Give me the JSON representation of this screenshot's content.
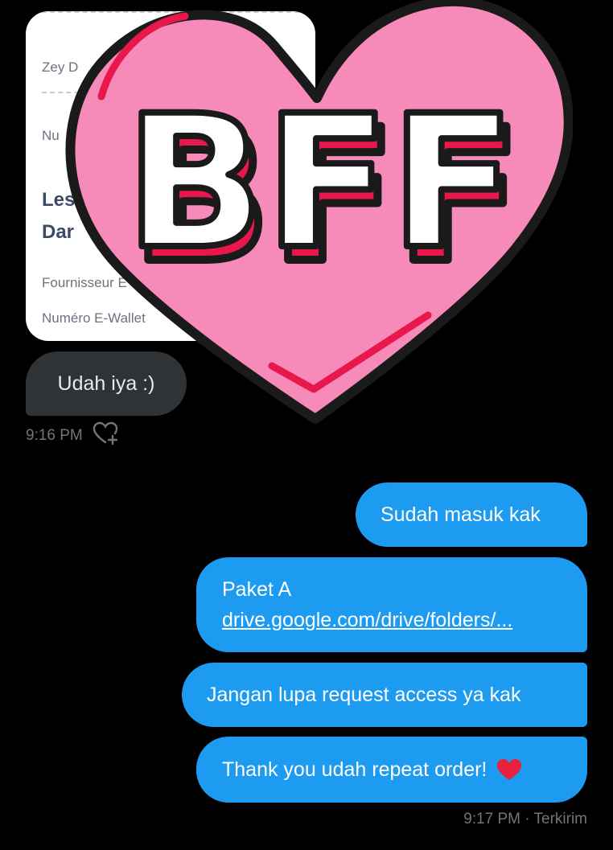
{
  "card": {
    "line1": "Zey D",
    "line2": "Nu",
    "title_line1": "Les",
    "title_line2": "Dar",
    "provider_label": "Fournisseur E",
    "ewallet_label": "Numéro E-Wallet"
  },
  "incoming": {
    "text": "Udah iya :)",
    "time": "9:16 PM"
  },
  "outgoing": [
    {
      "text": "Sudah masuk kak"
    },
    {
      "text": "Paket A",
      "link": "drive.google.com/drive/folders/..."
    },
    {
      "text": "Jangan lupa request access ya kak"
    },
    {
      "text": "Thank you udah repeat order!"
    }
  ],
  "outgoing_meta": {
    "time": "9:17 PM",
    "separator": " · ",
    "status": "Terkirim"
  },
  "sticker": {
    "text": "BFF"
  },
  "colors": {
    "background": "#000000",
    "outgoing_bubble": "#1d9bf0",
    "incoming_bubble": "#2f3336",
    "heart": "#f68ab8",
    "heart_outline": "#1a1a1a",
    "accent_red": "#e8174c"
  },
  "icons": {
    "react": "heart-plus-icon",
    "emoji": "red-heart-icon"
  }
}
